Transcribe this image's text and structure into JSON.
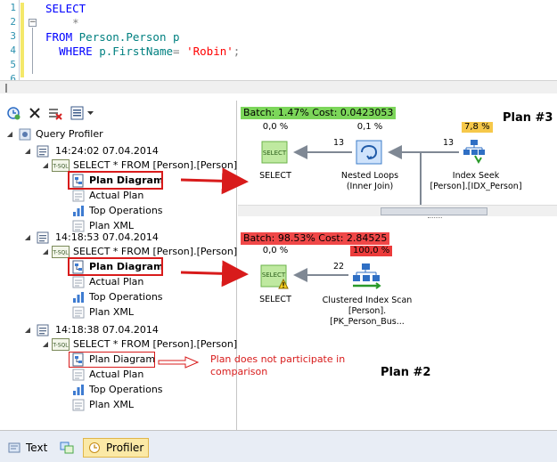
{
  "editor": {
    "line_numbers": [
      "1",
      "2",
      "3",
      "4",
      "5",
      "6"
    ],
    "code": {
      "select_kw": "SELECT",
      "star": "*",
      "from_kw": "FROM",
      "table": "Person.Person",
      "alias": "p",
      "where_kw": "WHERE",
      "column": "p.FirstName",
      "eq": "=",
      "value": "'Robin'",
      "semicolon": ";"
    }
  },
  "tree": {
    "root": "Query Profiler",
    "sessions": [
      {
        "timestamp": "14:24:02 07.04.2014",
        "query": "SELECT * FROM [Person].[Person] [",
        "items": [
          "Plan Diagram",
          "Actual Plan",
          "Top Operations",
          "Plan XML"
        ]
      },
      {
        "timestamp": "14:18:53 07.04.2014",
        "query": "SELECT * FROM [Person].[Person] [",
        "items": [
          "Plan Diagram",
          "Actual Plan",
          "Top Operations",
          "Plan XML"
        ]
      },
      {
        "timestamp": "14:18:38 07.04.2014",
        "query": "SELECT * FROM [Person].[Person] [",
        "items": [
          "Plan Diagram",
          "Actual Plan",
          "Top Operations",
          "Plan XML"
        ]
      }
    ],
    "tsql_badge": "T-SQL"
  },
  "annotation": {
    "not_participate": "Plan does not participate in comparison"
  },
  "plan3": {
    "batch": "Batch: 1.47% Cost: 0.0423053",
    "label": "Plan #3",
    "select": {
      "pct": "0,0 %",
      "name": "SELECT",
      "icon_text": "SELECT"
    },
    "nested": {
      "pct": "0,1 %",
      "name": "Nested Loops",
      "sub": "(Inner Join)"
    },
    "seek": {
      "pct": "7,8 %",
      "name": "Index Seek",
      "sub": "[Person].[IDX_Person]"
    },
    "rows_a": "13",
    "rows_b": "13"
  },
  "plan2": {
    "batch": "Batch: 98.53% Cost: 2.84525",
    "label": "Plan #2",
    "select": {
      "pct": "0,0 %",
      "name": "SELECT",
      "icon_text": "SELECT"
    },
    "scan": {
      "pct": "100,0 %",
      "name": "Clustered Index Scan",
      "sub": "[Person].[PK_Person_Bus..."
    },
    "rows": "22"
  },
  "bottom": {
    "text_tab": "Text",
    "profiler_tab": "Profiler"
  },
  "colors": {
    "batch_green": "#7cd65a",
    "batch_red": "#f04848",
    "badge_yellow": "#f6c84a",
    "badge_red": "#ec3b3b",
    "annotation_red": "#d81b1b"
  }
}
